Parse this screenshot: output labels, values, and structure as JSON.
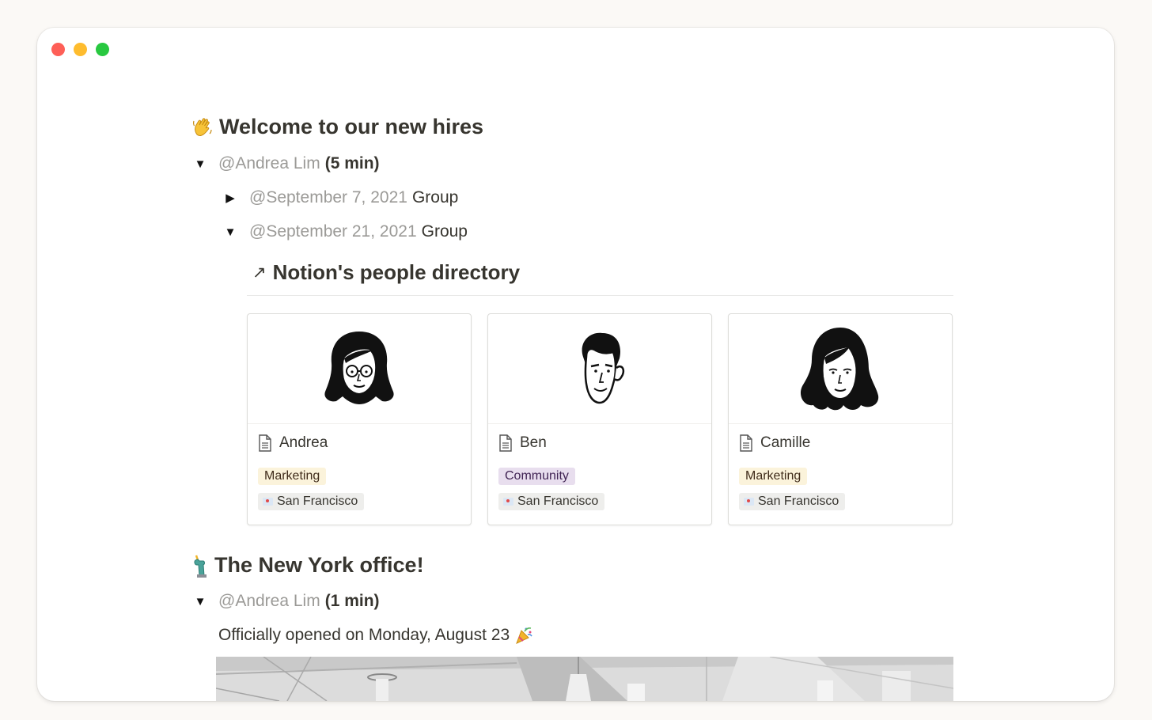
{
  "window": {
    "title": ""
  },
  "section1": {
    "heading": "Welcome to our new hires",
    "heading_icon": "waving-hand-emoji",
    "toggle": {
      "mention": "@Andrea Lim",
      "suffix": "(5 min)"
    },
    "subtoggles": [
      {
        "date": "@September 7, 2021",
        "label": "Group",
        "expanded": false
      },
      {
        "date": "@September 21, 2021",
        "label": "Group",
        "expanded": true
      }
    ],
    "linked_db": {
      "arrow": "↗",
      "title": "Notion's people directory"
    },
    "cards": [
      {
        "name": "Andrea",
        "tag": "Marketing",
        "tag_color": "#fbf3db",
        "location": "San Francisco",
        "icon": "page-icon"
      },
      {
        "name": "Ben",
        "tag": "Community",
        "tag_color": "#e8deee",
        "location": "San Francisco",
        "icon": "page-icon"
      },
      {
        "name": "Camille",
        "tag": "Marketing",
        "tag_color": "#fbf3db",
        "location": "San Francisco",
        "icon": "page-icon"
      }
    ]
  },
  "section2": {
    "heading": "The New York office!",
    "heading_icon": "statue-of-liberty-emoji",
    "toggle": {
      "mention": "@Andrea Lim",
      "suffix": "(1 min)"
    },
    "body": "Officially opened on Monday, August 23",
    "body_icon": "party-popper-emoji"
  },
  "colors": {
    "traffic_red": "#fe5f57",
    "traffic_yellow": "#febc2e",
    "traffic_green": "#28c840",
    "mention_gray": "#9b9a97",
    "text": "#37352f"
  }
}
